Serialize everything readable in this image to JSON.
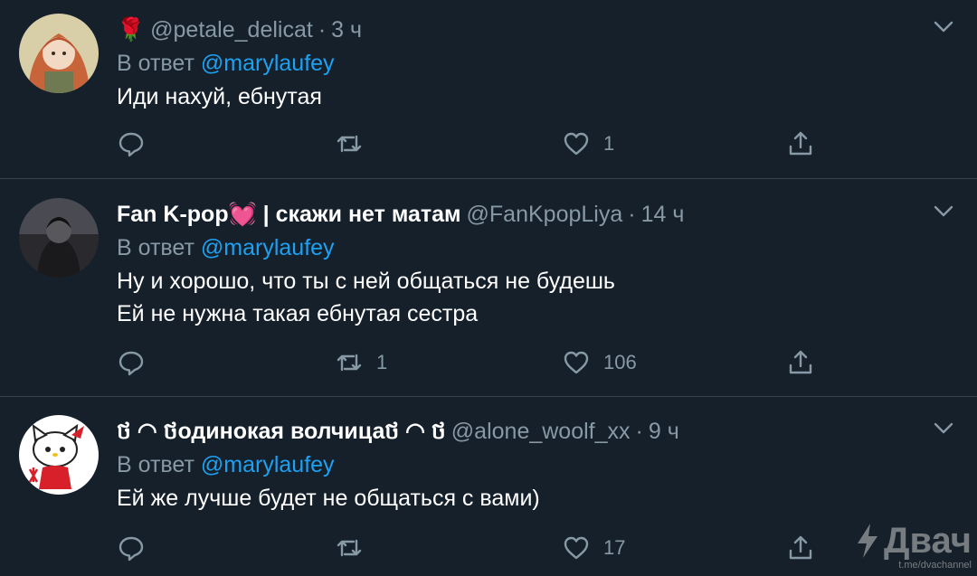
{
  "tweets": [
    {
      "name_prefix": "🌹",
      "display_name": "",
      "handle": "@petale_delicat",
      "separator": "·",
      "time": "3 ч",
      "reply_prefix": "В ответ",
      "reply_to": "@marylaufey",
      "lines": [
        "Иди нахуй, ебнутая"
      ],
      "replies": "",
      "retweets": "",
      "likes": "1"
    },
    {
      "name_prefix": "",
      "display_name": "Fan K-pop💓 | скажи нет матам",
      "handle": "@FanKpopLiya",
      "separator": "·",
      "time": "14 ч",
      "reply_prefix": "В ответ",
      "reply_to": "@marylaufey",
      "lines": [
        "Ну и хорошо, что ты с ней общаться не будешь",
        "Ей не нужна такая ебнутая сестра"
      ],
      "replies": "",
      "retweets": "1",
      "likes": "106"
    },
    {
      "name_prefix": "",
      "display_name": "ថ ◠ ថодинокая волчицаថ ◠ ថ",
      "handle": "@alone_woolf_xx",
      "separator": "·",
      "time": "9 ч",
      "reply_prefix": "В ответ",
      "reply_to": "@marylaufey",
      "lines": [
        "Ей же лучше будет не общаться с вами)"
      ],
      "replies": "",
      "retweets": "",
      "likes": "17"
    }
  ],
  "icons": {
    "reply": "reply-icon",
    "retweet": "retweet-icon",
    "like": "heart-icon",
    "share": "share-icon",
    "caret": "chevron-down-icon"
  },
  "colors": {
    "background": "#15202b",
    "divider": "#38444d",
    "muted": "#8899a6",
    "mention": "#1da1f2"
  },
  "watermark": {
    "main": "Двач",
    "sub": "t.me/dvachannel"
  }
}
